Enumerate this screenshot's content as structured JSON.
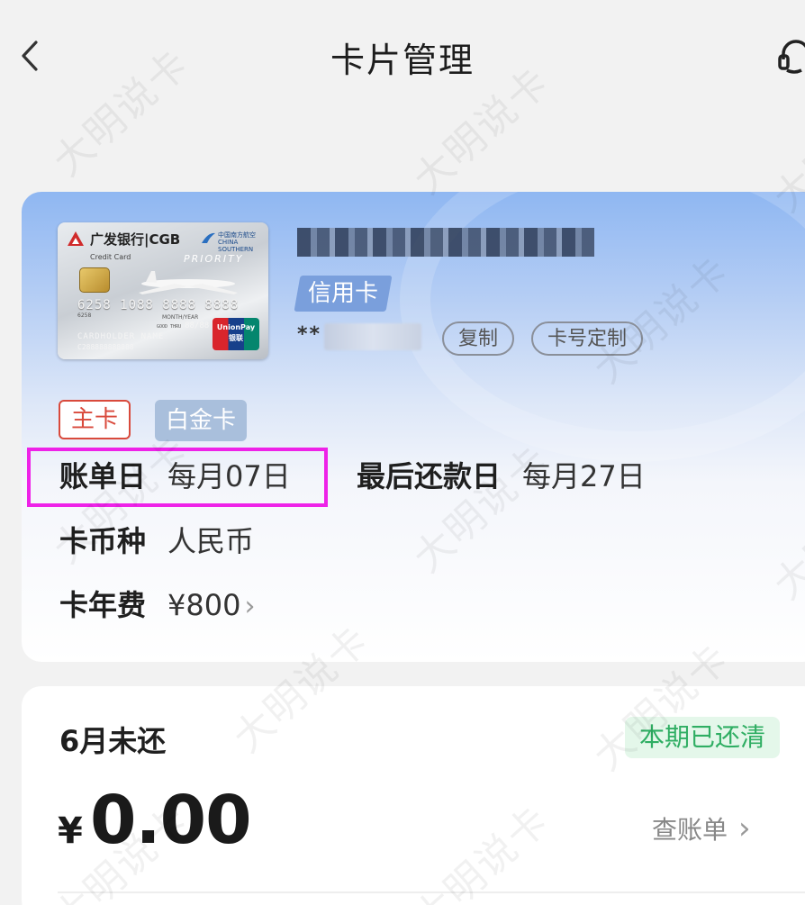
{
  "header": {
    "title": "卡片管理"
  },
  "card_panel": {
    "card_image": {
      "bank_name": "广发银行|CGB",
      "airline_line1": "中国南方航空",
      "airline_line2": "CHINA SOUTHERN",
      "card_label": "Credit Card",
      "priority_text": "PRIORITY",
      "card_number": "6258 1088 8888 8888",
      "card_number_small": "6258",
      "month_year_label": "MONTH/YEAR",
      "valid_thru_label": "GOOD THRU",
      "expiry": "88/88",
      "holder_name": "CARDHOLDER NAME",
      "holder_number": "C288888888888",
      "network_en": "UnionPay",
      "network_cn": "银联"
    },
    "card_type_tag": "信用卡",
    "card_number_prefix": "**",
    "copy_label": "复制",
    "custom_number_label": "卡号定制",
    "badges": {
      "main": "主卡",
      "level": "白金卡"
    },
    "bill_day": {
      "label": "账单日",
      "value": "每月07日"
    },
    "due_day": {
      "label": "最后还款日",
      "value": "每月27日"
    },
    "currency": {
      "label": "卡币种",
      "value": "人民币"
    },
    "annual_fee": {
      "label": "卡年费",
      "value": "¥800"
    }
  },
  "bill_panel": {
    "month_label": "6月未还",
    "status": "本期已还清",
    "currency_symbol": "¥",
    "amount": "0.00",
    "view_bill_label": "查账单"
  },
  "watermark_text": "大明说卡",
  "colors": {
    "highlight": "#ee22e8",
    "status_green": "#2fae63",
    "main_badge_red": "#d94a3c",
    "type_tag_blue": "#7a9fdc"
  }
}
